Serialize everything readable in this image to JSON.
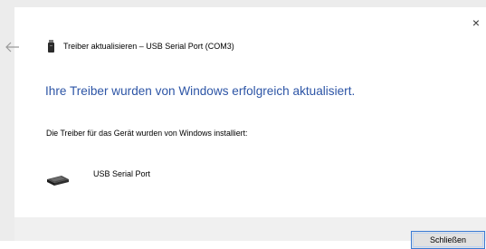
{
  "window": {
    "close_glyph": "×",
    "back_glyph": "←"
  },
  "header": {
    "title": "Treiber aktualisieren – USB Serial Port (COM3)"
  },
  "main": {
    "heading": "Ihre Treiber wurden von Windows erfolgreich aktualisiert.",
    "info": "Die Treiber für das Gerät wurden von Windows installiert:",
    "device": {
      "name": "USB Serial Port",
      "icon": "usb-device-icon"
    }
  },
  "footer": {
    "close_label": "Schließen"
  },
  "colors": {
    "heading": "#2d55a6",
    "footer_bg": "#f0f0f0",
    "button_border": "#3a7bd5"
  }
}
